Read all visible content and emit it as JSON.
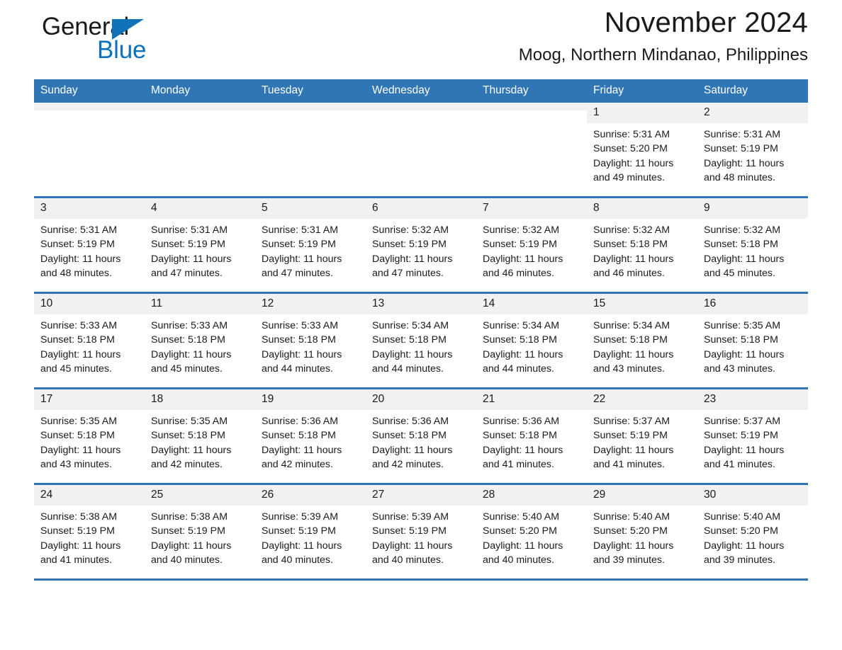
{
  "logo": {
    "word1": "General",
    "word2": "Blue",
    "triangle_color": "#1272b8",
    "blue_text_color": "#0d72bd"
  },
  "header": {
    "title": "November 2024",
    "subtitle": "Moog, Northern Mindanao, Philippines"
  },
  "theme": {
    "header_blue": "#3076b4",
    "row_rule_blue": "#2e75b6",
    "daynum_band": "#f1f1f1"
  },
  "weekday_headers": [
    "Sunday",
    "Monday",
    "Tuesday",
    "Wednesday",
    "Thursday",
    "Friday",
    "Saturday"
  ],
  "weeks": [
    [
      {
        "day": "",
        "lines": []
      },
      {
        "day": "",
        "lines": []
      },
      {
        "day": "",
        "lines": []
      },
      {
        "day": "",
        "lines": []
      },
      {
        "day": "",
        "lines": []
      },
      {
        "day": "1",
        "lines": [
          "Sunrise: 5:31 AM",
          "Sunset: 5:20 PM",
          "Daylight: 11 hours",
          "and 49 minutes."
        ]
      },
      {
        "day": "2",
        "lines": [
          "Sunrise: 5:31 AM",
          "Sunset: 5:19 PM",
          "Daylight: 11 hours",
          "and 48 minutes."
        ]
      }
    ],
    [
      {
        "day": "3",
        "lines": [
          "Sunrise: 5:31 AM",
          "Sunset: 5:19 PM",
          "Daylight: 11 hours",
          "and 48 minutes."
        ]
      },
      {
        "day": "4",
        "lines": [
          "Sunrise: 5:31 AM",
          "Sunset: 5:19 PM",
          "Daylight: 11 hours",
          "and 47 minutes."
        ]
      },
      {
        "day": "5",
        "lines": [
          "Sunrise: 5:31 AM",
          "Sunset: 5:19 PM",
          "Daylight: 11 hours",
          "and 47 minutes."
        ]
      },
      {
        "day": "6",
        "lines": [
          "Sunrise: 5:32 AM",
          "Sunset: 5:19 PM",
          "Daylight: 11 hours",
          "and 47 minutes."
        ]
      },
      {
        "day": "7",
        "lines": [
          "Sunrise: 5:32 AM",
          "Sunset: 5:19 PM",
          "Daylight: 11 hours",
          "and 46 minutes."
        ]
      },
      {
        "day": "8",
        "lines": [
          "Sunrise: 5:32 AM",
          "Sunset: 5:18 PM",
          "Daylight: 11 hours",
          "and 46 minutes."
        ]
      },
      {
        "day": "9",
        "lines": [
          "Sunrise: 5:32 AM",
          "Sunset: 5:18 PM",
          "Daylight: 11 hours",
          "and 45 minutes."
        ]
      }
    ],
    [
      {
        "day": "10",
        "lines": [
          "Sunrise: 5:33 AM",
          "Sunset: 5:18 PM",
          "Daylight: 11 hours",
          "and 45 minutes."
        ]
      },
      {
        "day": "11",
        "lines": [
          "Sunrise: 5:33 AM",
          "Sunset: 5:18 PM",
          "Daylight: 11 hours",
          "and 45 minutes."
        ]
      },
      {
        "day": "12",
        "lines": [
          "Sunrise: 5:33 AM",
          "Sunset: 5:18 PM",
          "Daylight: 11 hours",
          "and 44 minutes."
        ]
      },
      {
        "day": "13",
        "lines": [
          "Sunrise: 5:34 AM",
          "Sunset: 5:18 PM",
          "Daylight: 11 hours",
          "and 44 minutes."
        ]
      },
      {
        "day": "14",
        "lines": [
          "Sunrise: 5:34 AM",
          "Sunset: 5:18 PM",
          "Daylight: 11 hours",
          "and 44 minutes."
        ]
      },
      {
        "day": "15",
        "lines": [
          "Sunrise: 5:34 AM",
          "Sunset: 5:18 PM",
          "Daylight: 11 hours",
          "and 43 minutes."
        ]
      },
      {
        "day": "16",
        "lines": [
          "Sunrise: 5:35 AM",
          "Sunset: 5:18 PM",
          "Daylight: 11 hours",
          "and 43 minutes."
        ]
      }
    ],
    [
      {
        "day": "17",
        "lines": [
          "Sunrise: 5:35 AM",
          "Sunset: 5:18 PM",
          "Daylight: 11 hours",
          "and 43 minutes."
        ]
      },
      {
        "day": "18",
        "lines": [
          "Sunrise: 5:35 AM",
          "Sunset: 5:18 PM",
          "Daylight: 11 hours",
          "and 42 minutes."
        ]
      },
      {
        "day": "19",
        "lines": [
          "Sunrise: 5:36 AM",
          "Sunset: 5:18 PM",
          "Daylight: 11 hours",
          "and 42 minutes."
        ]
      },
      {
        "day": "20",
        "lines": [
          "Sunrise: 5:36 AM",
          "Sunset: 5:18 PM",
          "Daylight: 11 hours",
          "and 42 minutes."
        ]
      },
      {
        "day": "21",
        "lines": [
          "Sunrise: 5:36 AM",
          "Sunset: 5:18 PM",
          "Daylight: 11 hours",
          "and 41 minutes."
        ]
      },
      {
        "day": "22",
        "lines": [
          "Sunrise: 5:37 AM",
          "Sunset: 5:19 PM",
          "Daylight: 11 hours",
          "and 41 minutes."
        ]
      },
      {
        "day": "23",
        "lines": [
          "Sunrise: 5:37 AM",
          "Sunset: 5:19 PM",
          "Daylight: 11 hours",
          "and 41 minutes."
        ]
      }
    ],
    [
      {
        "day": "24",
        "lines": [
          "Sunrise: 5:38 AM",
          "Sunset: 5:19 PM",
          "Daylight: 11 hours",
          "and 41 minutes."
        ]
      },
      {
        "day": "25",
        "lines": [
          "Sunrise: 5:38 AM",
          "Sunset: 5:19 PM",
          "Daylight: 11 hours",
          "and 40 minutes."
        ]
      },
      {
        "day": "26",
        "lines": [
          "Sunrise: 5:39 AM",
          "Sunset: 5:19 PM",
          "Daylight: 11 hours",
          "and 40 minutes."
        ]
      },
      {
        "day": "27",
        "lines": [
          "Sunrise: 5:39 AM",
          "Sunset: 5:19 PM",
          "Daylight: 11 hours",
          "and 40 minutes."
        ]
      },
      {
        "day": "28",
        "lines": [
          "Sunrise: 5:40 AM",
          "Sunset: 5:20 PM",
          "Daylight: 11 hours",
          "and 40 minutes."
        ]
      },
      {
        "day": "29",
        "lines": [
          "Sunrise: 5:40 AM",
          "Sunset: 5:20 PM",
          "Daylight: 11 hours",
          "and 39 minutes."
        ]
      },
      {
        "day": "30",
        "lines": [
          "Sunrise: 5:40 AM",
          "Sunset: 5:20 PM",
          "Daylight: 11 hours",
          "and 39 minutes."
        ]
      }
    ]
  ]
}
